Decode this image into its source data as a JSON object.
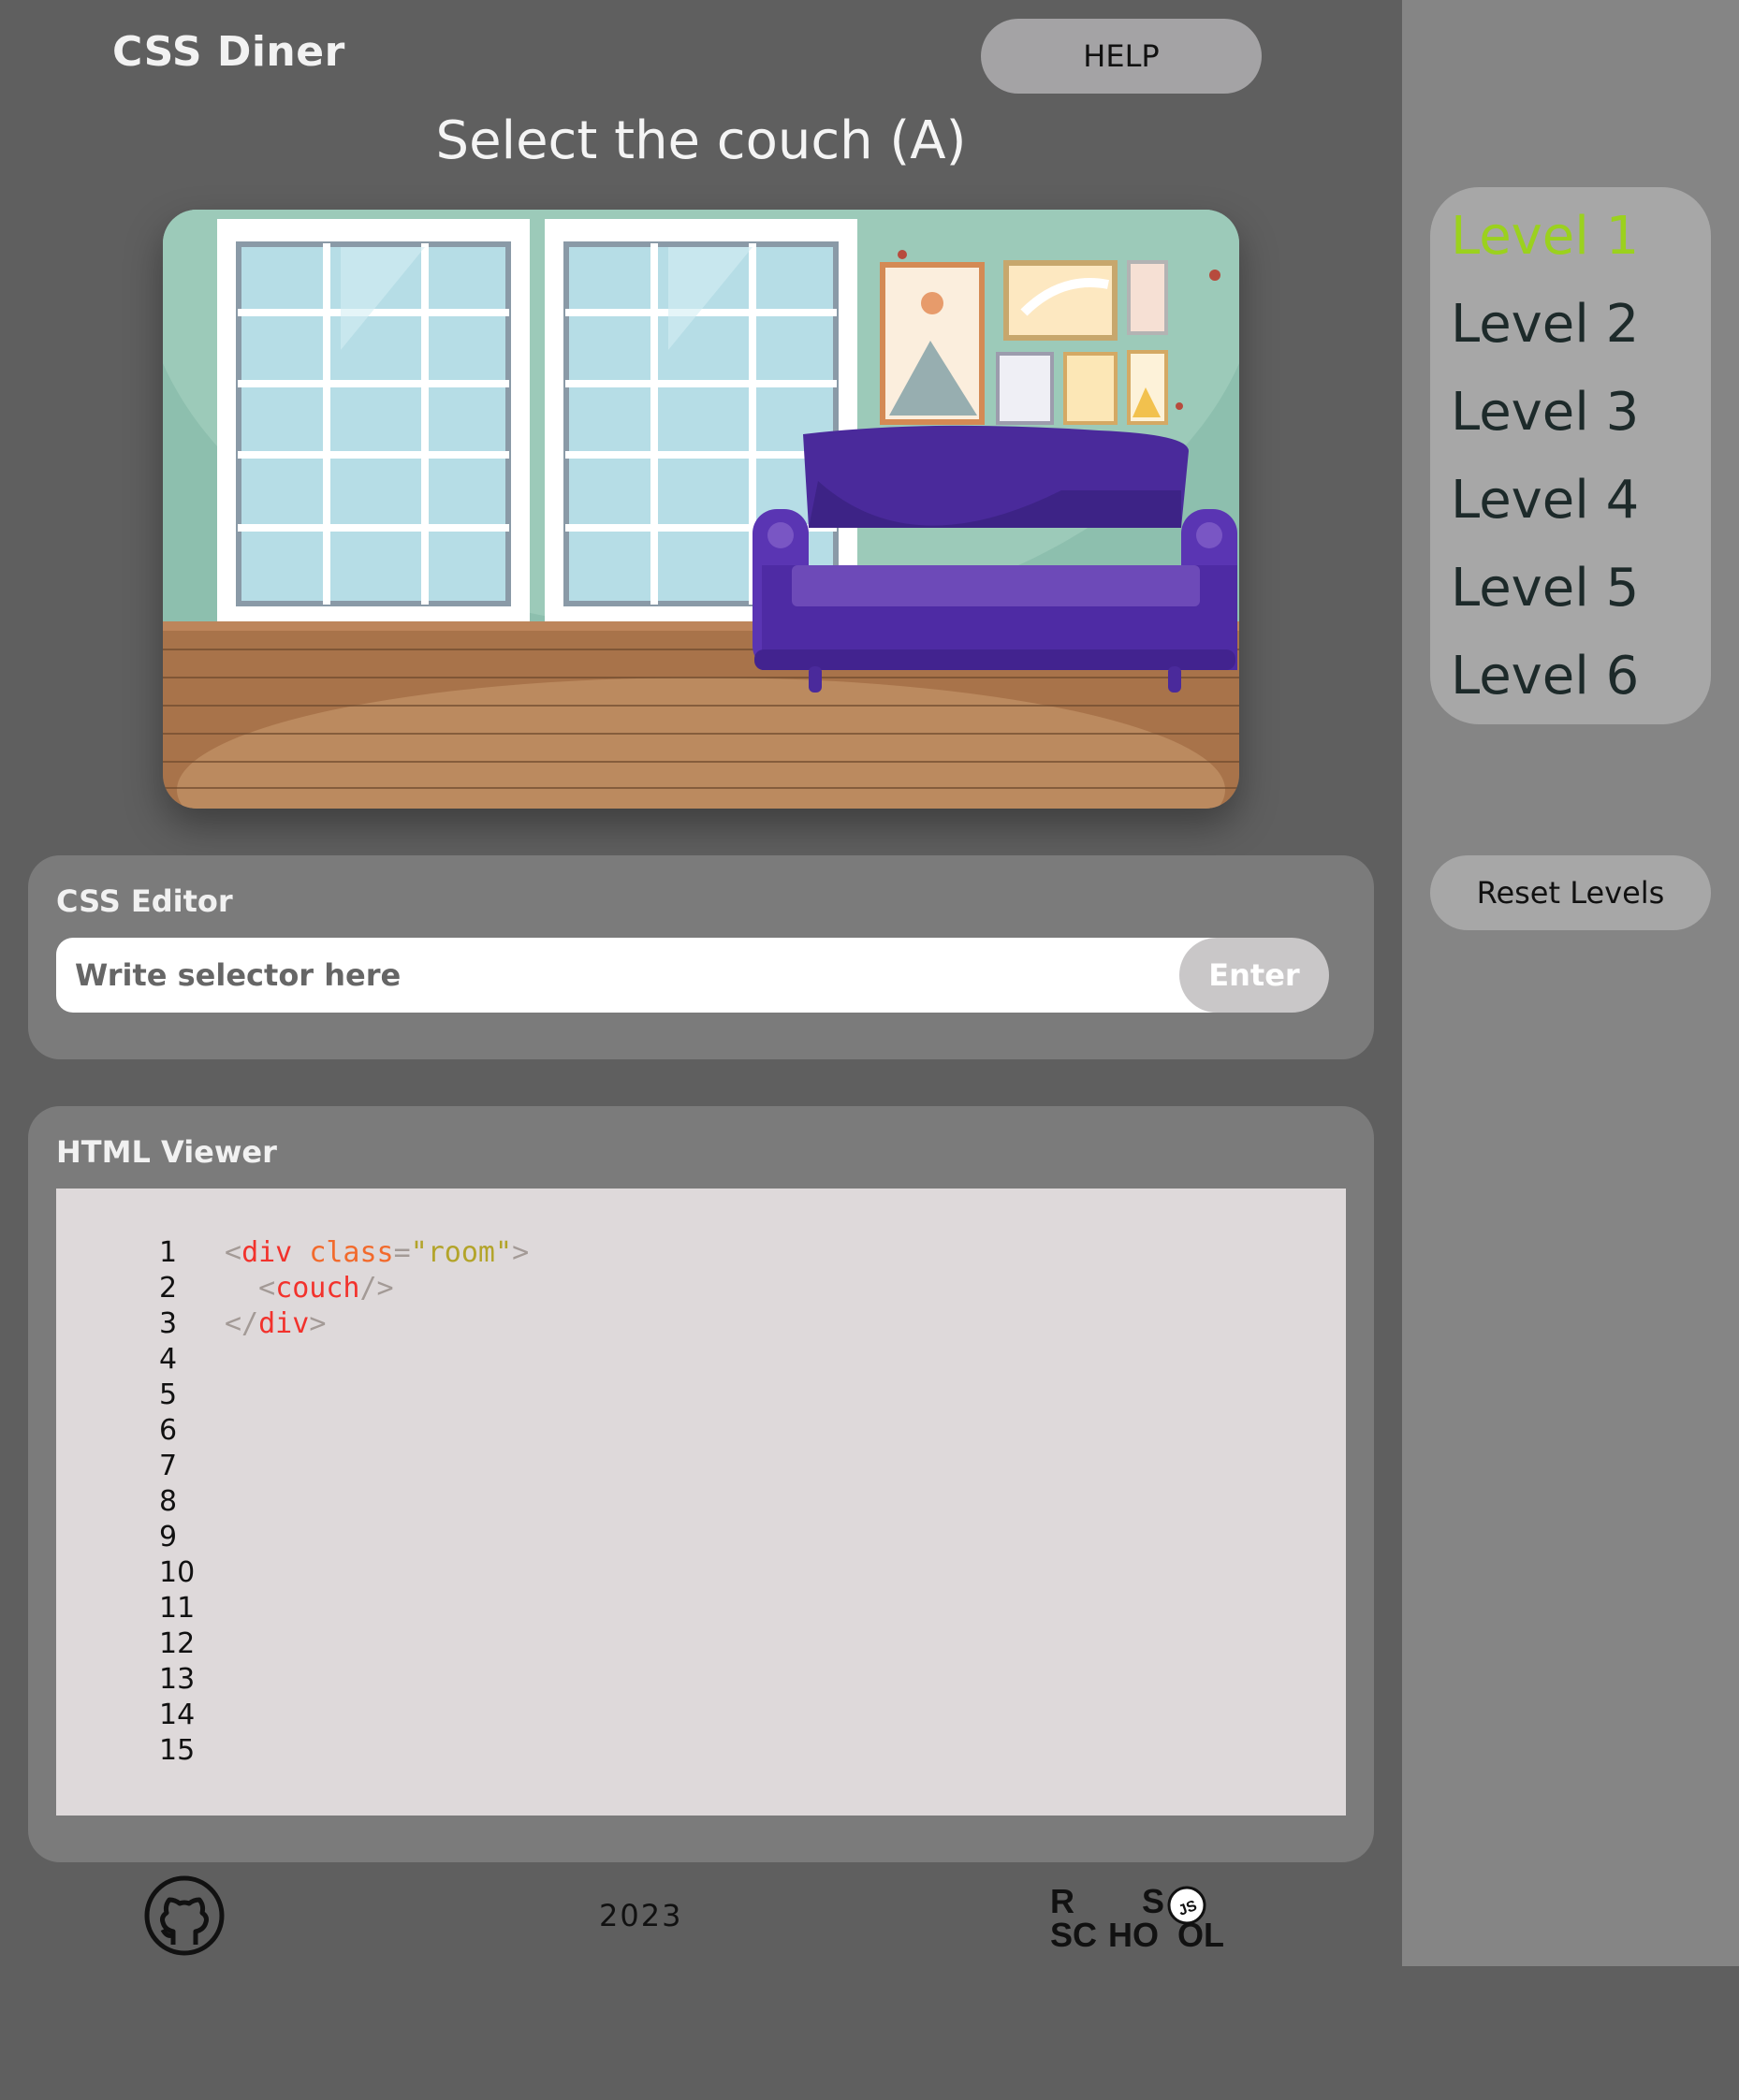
{
  "header": {
    "app_title": "CSS Diner",
    "help_label": "HELP"
  },
  "task": {
    "title": "Select the couch (A)"
  },
  "editor": {
    "label": "CSS Editor",
    "placeholder": "Write selector here",
    "value": "",
    "enter_label": "Enter"
  },
  "viewer": {
    "label": "HTML Viewer",
    "line_numbers": [
      "1",
      "2",
      "3",
      "4",
      "5",
      "6",
      "7",
      "8",
      "9",
      "10",
      "11",
      "12",
      "13",
      "14",
      "15"
    ],
    "lines": [
      {
        "indent": "",
        "open": "<",
        "tag": "div",
        "space": " ",
        "attr": "class",
        "eq": "=",
        "str": "\"room\"",
        "close": ">"
      },
      {
        "indent": "  ",
        "open": "<",
        "tag": "couch",
        "space": "",
        "attr": "",
        "eq": "",
        "str": "",
        "close": "/>"
      },
      {
        "indent": "",
        "open": "</",
        "tag": "div",
        "space": "",
        "attr": "",
        "eq": "",
        "str": "",
        "close": ">"
      }
    ]
  },
  "footer": {
    "year": "2023",
    "github_icon": "github-icon",
    "logo": "rs-school-js-logo"
  },
  "sidebar": {
    "levels": [
      "Level 1",
      "Level 2",
      "Level 3",
      "Level 4",
      "Level 5",
      "Level 6"
    ],
    "active_level": "Level 1",
    "reset_label": "Reset Levels"
  },
  "colors": {
    "background": "#5f5f5f",
    "sidebar": "#858585",
    "panel": "#7b7b7b",
    "active_level": "#9bd11e",
    "code_tag": "#f2322c",
    "code_attr": "#f26a2c",
    "code_string": "#b3a42a"
  }
}
